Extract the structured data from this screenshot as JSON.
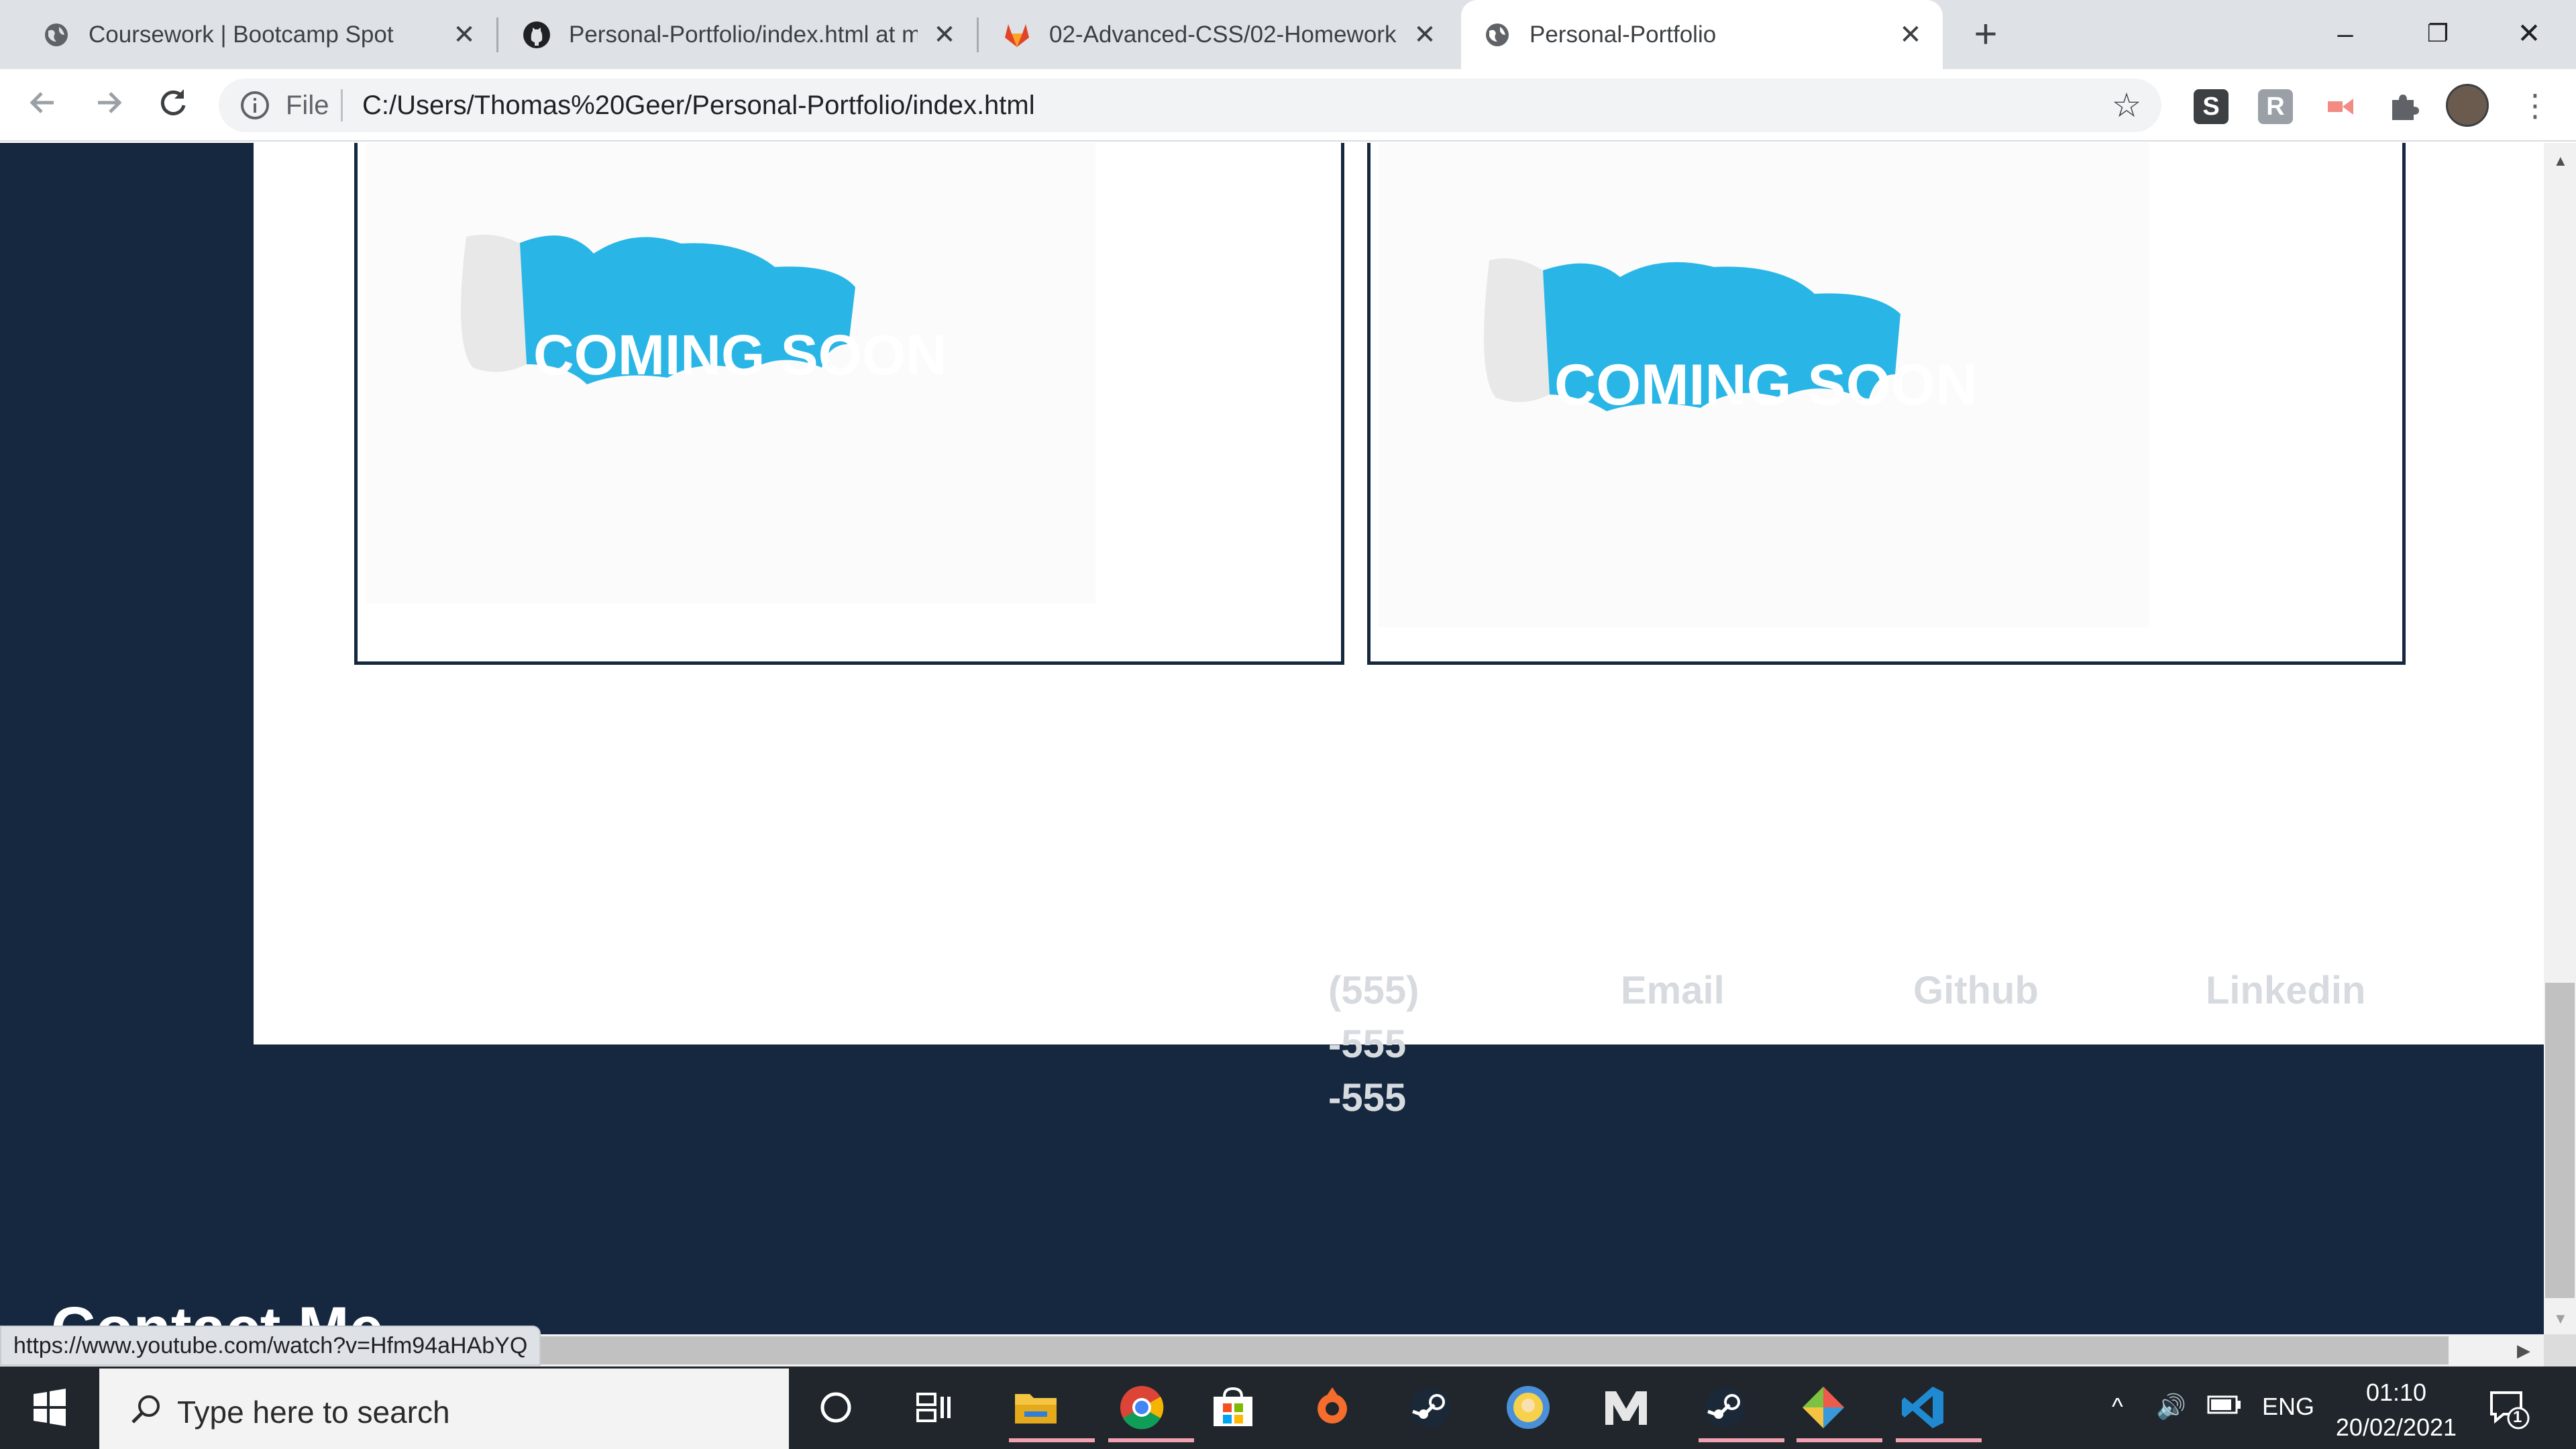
{
  "browser": {
    "tabs": [
      {
        "title": "Coursework | Bootcamp Spot",
        "icon": "globe-icon"
      },
      {
        "title": "Personal-Portfolio/index.html at m",
        "icon": "github-icon"
      },
      {
        "title": "02-Advanced-CSS/02-Homework",
        "icon": "gitlab-icon"
      },
      {
        "title": "Personal-Portfolio",
        "icon": "globe-icon",
        "active": true
      }
    ],
    "new_tab": "+",
    "address": {
      "scheme_label": "File",
      "url": "C:/Users/Thomas%20Geer/Personal-Portfolio/index.html"
    },
    "window_controls": {
      "minimize": "–",
      "restore": "❐",
      "close": "✕"
    }
  },
  "page": {
    "cards": [
      {
        "image_text": "COMING SOON"
      },
      {
        "image_text": "COMING SOON"
      }
    ],
    "footer": {
      "title": "Contact Me",
      "phone_lines": [
        "(555)",
        "-555",
        "-555"
      ],
      "links": [
        "Email",
        "Github",
        "Linkedin"
      ]
    },
    "status_url": "https://www.youtube.com/watch?v=Hfm94aHAbYQ"
  },
  "taskbar": {
    "search_placeholder": "Type here to search",
    "language": "ENG",
    "time": "01:10",
    "date": "20/02/2021",
    "notification_count": "1",
    "apps": [
      "cortana-icon",
      "task-view-icon",
      "file-explorer-icon",
      "chrome-icon",
      "store-icon",
      "origin-icon",
      "steam-icon",
      "fallout-shelter-icon",
      "m2-icon",
      "steam-icon",
      "gitkraken-icon",
      "vscode-icon"
    ]
  },
  "colors": {
    "navy": "#152840",
    "coming_soon_blue": "#29b6e6",
    "footer_text": "#d7dbe0"
  }
}
